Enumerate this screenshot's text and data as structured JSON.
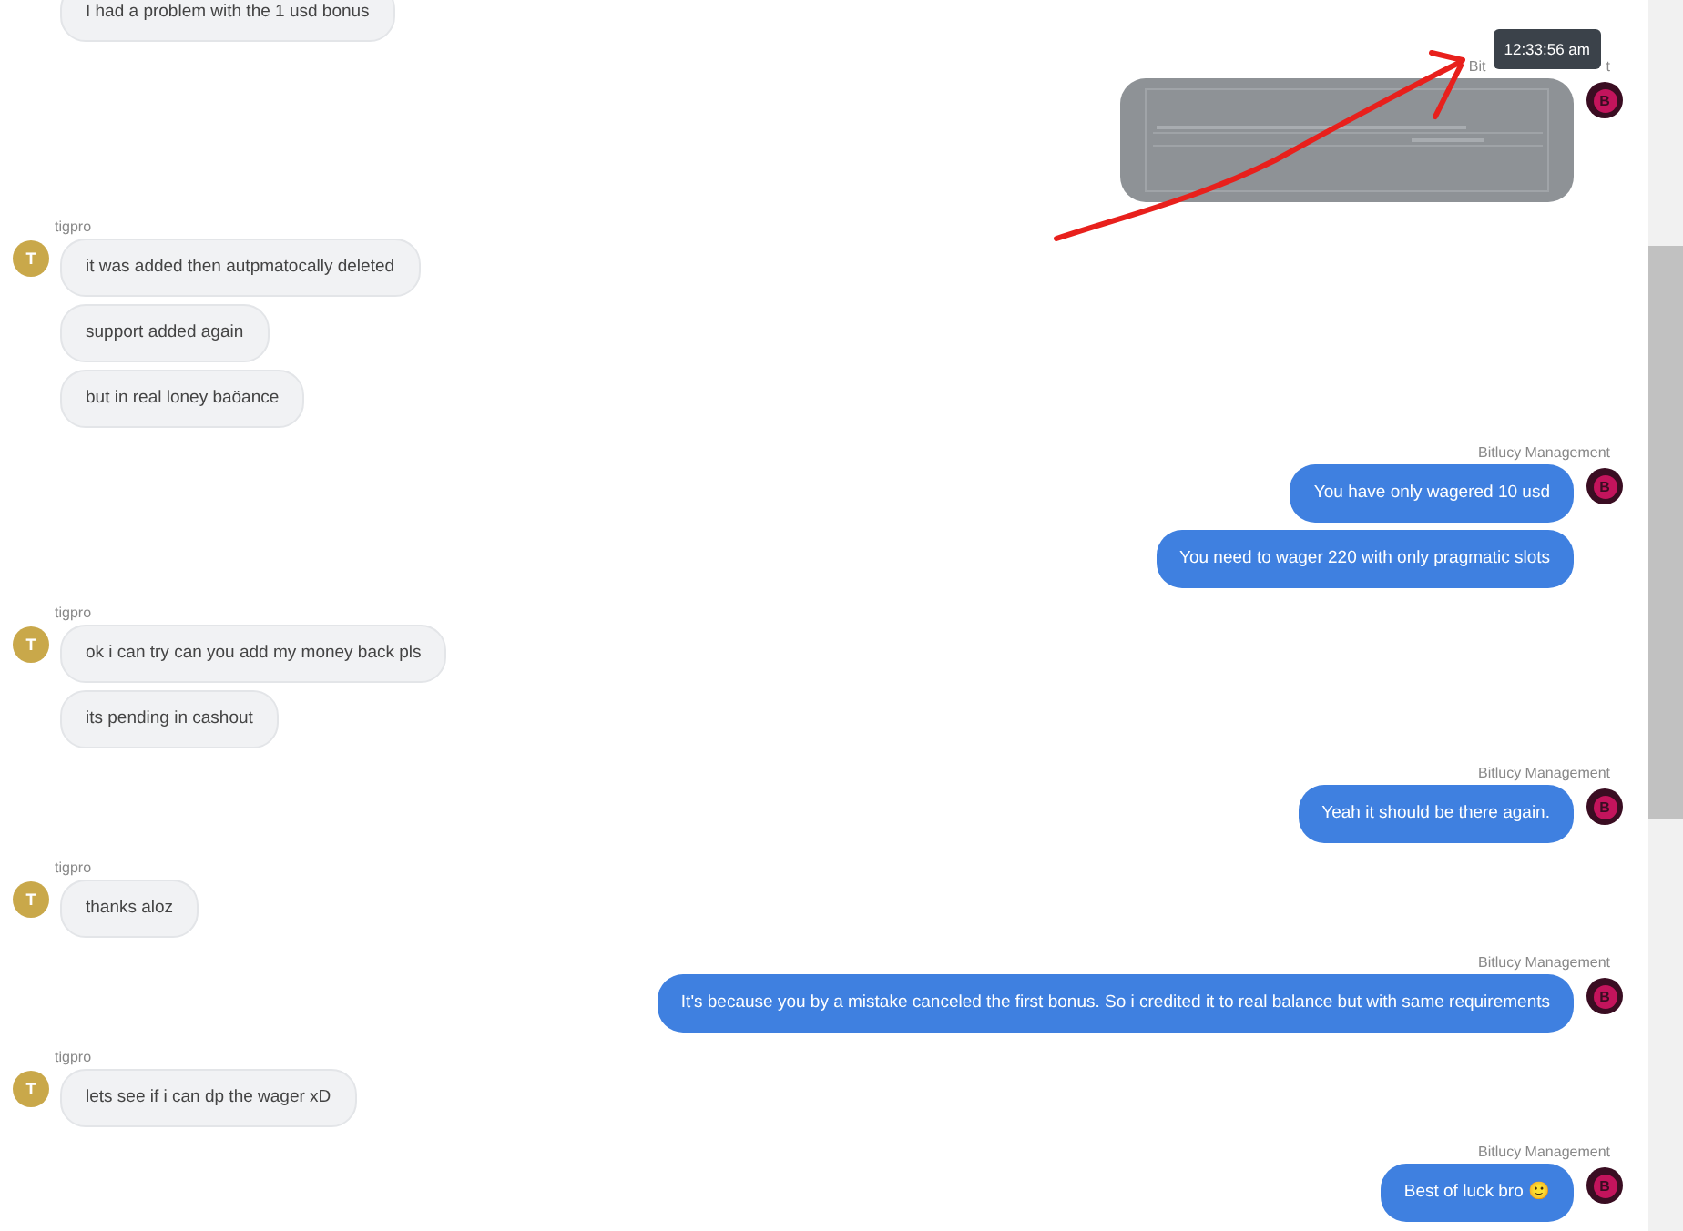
{
  "groups": [
    {
      "kind": "incoming",
      "messages": [
        {
          "kind": "text",
          "text": "I had a problem with the 1 usd bonus"
        }
      ]
    },
    {
      "kind": "outgoing",
      "sender_fragments": [
        "Bit",
        "t"
      ],
      "tooltip": "12:33:56 am",
      "avatar": "B",
      "messages": [
        {
          "kind": "image"
        }
      ]
    },
    {
      "kind": "incoming",
      "sender": "tigpro",
      "avatar": "T",
      "messages": [
        {
          "kind": "text",
          "text": "it was added then autpmatocally deleted"
        },
        {
          "kind": "text",
          "text": "support added again"
        },
        {
          "kind": "text",
          "text": "but in real loney baöance"
        }
      ]
    },
    {
      "kind": "outgoing",
      "sender": "Bitlucy Management",
      "avatar": "B",
      "messages": [
        {
          "kind": "text",
          "text": "You have only wagered 10 usd"
        },
        {
          "kind": "text",
          "text": "You need to wager 220 with only pragmatic slots"
        }
      ]
    },
    {
      "kind": "incoming",
      "sender": "tigpro",
      "avatar": "T",
      "messages": [
        {
          "kind": "text",
          "text": "ok i can try can you add my money back pls"
        },
        {
          "kind": "text",
          "text": "its pending in cashout"
        }
      ]
    },
    {
      "kind": "outgoing",
      "sender": "Bitlucy Management",
      "avatar": "B",
      "messages": [
        {
          "kind": "text",
          "text": "Yeah it should be there again."
        }
      ]
    },
    {
      "kind": "incoming",
      "sender": "tigpro",
      "avatar": "T",
      "messages": [
        {
          "kind": "text",
          "text": "thanks aloz"
        }
      ]
    },
    {
      "kind": "outgoing",
      "sender": "Bitlucy Management",
      "avatar": "B",
      "messages": [
        {
          "kind": "text",
          "text": "It's because you by a mistake canceled the first bonus. So i credited it to real balance but with same requirements"
        }
      ]
    },
    {
      "kind": "incoming",
      "sender": "tigpro",
      "avatar": "T",
      "messages": [
        {
          "kind": "text",
          "text": "lets see if i can dp the wager xD"
        }
      ]
    },
    {
      "kind": "outgoing",
      "sender": "Bitlucy Management",
      "avatar": "B",
      "messages": [
        {
          "kind": "text",
          "text": "Best of luck bro 🙂"
        }
      ]
    }
  ]
}
